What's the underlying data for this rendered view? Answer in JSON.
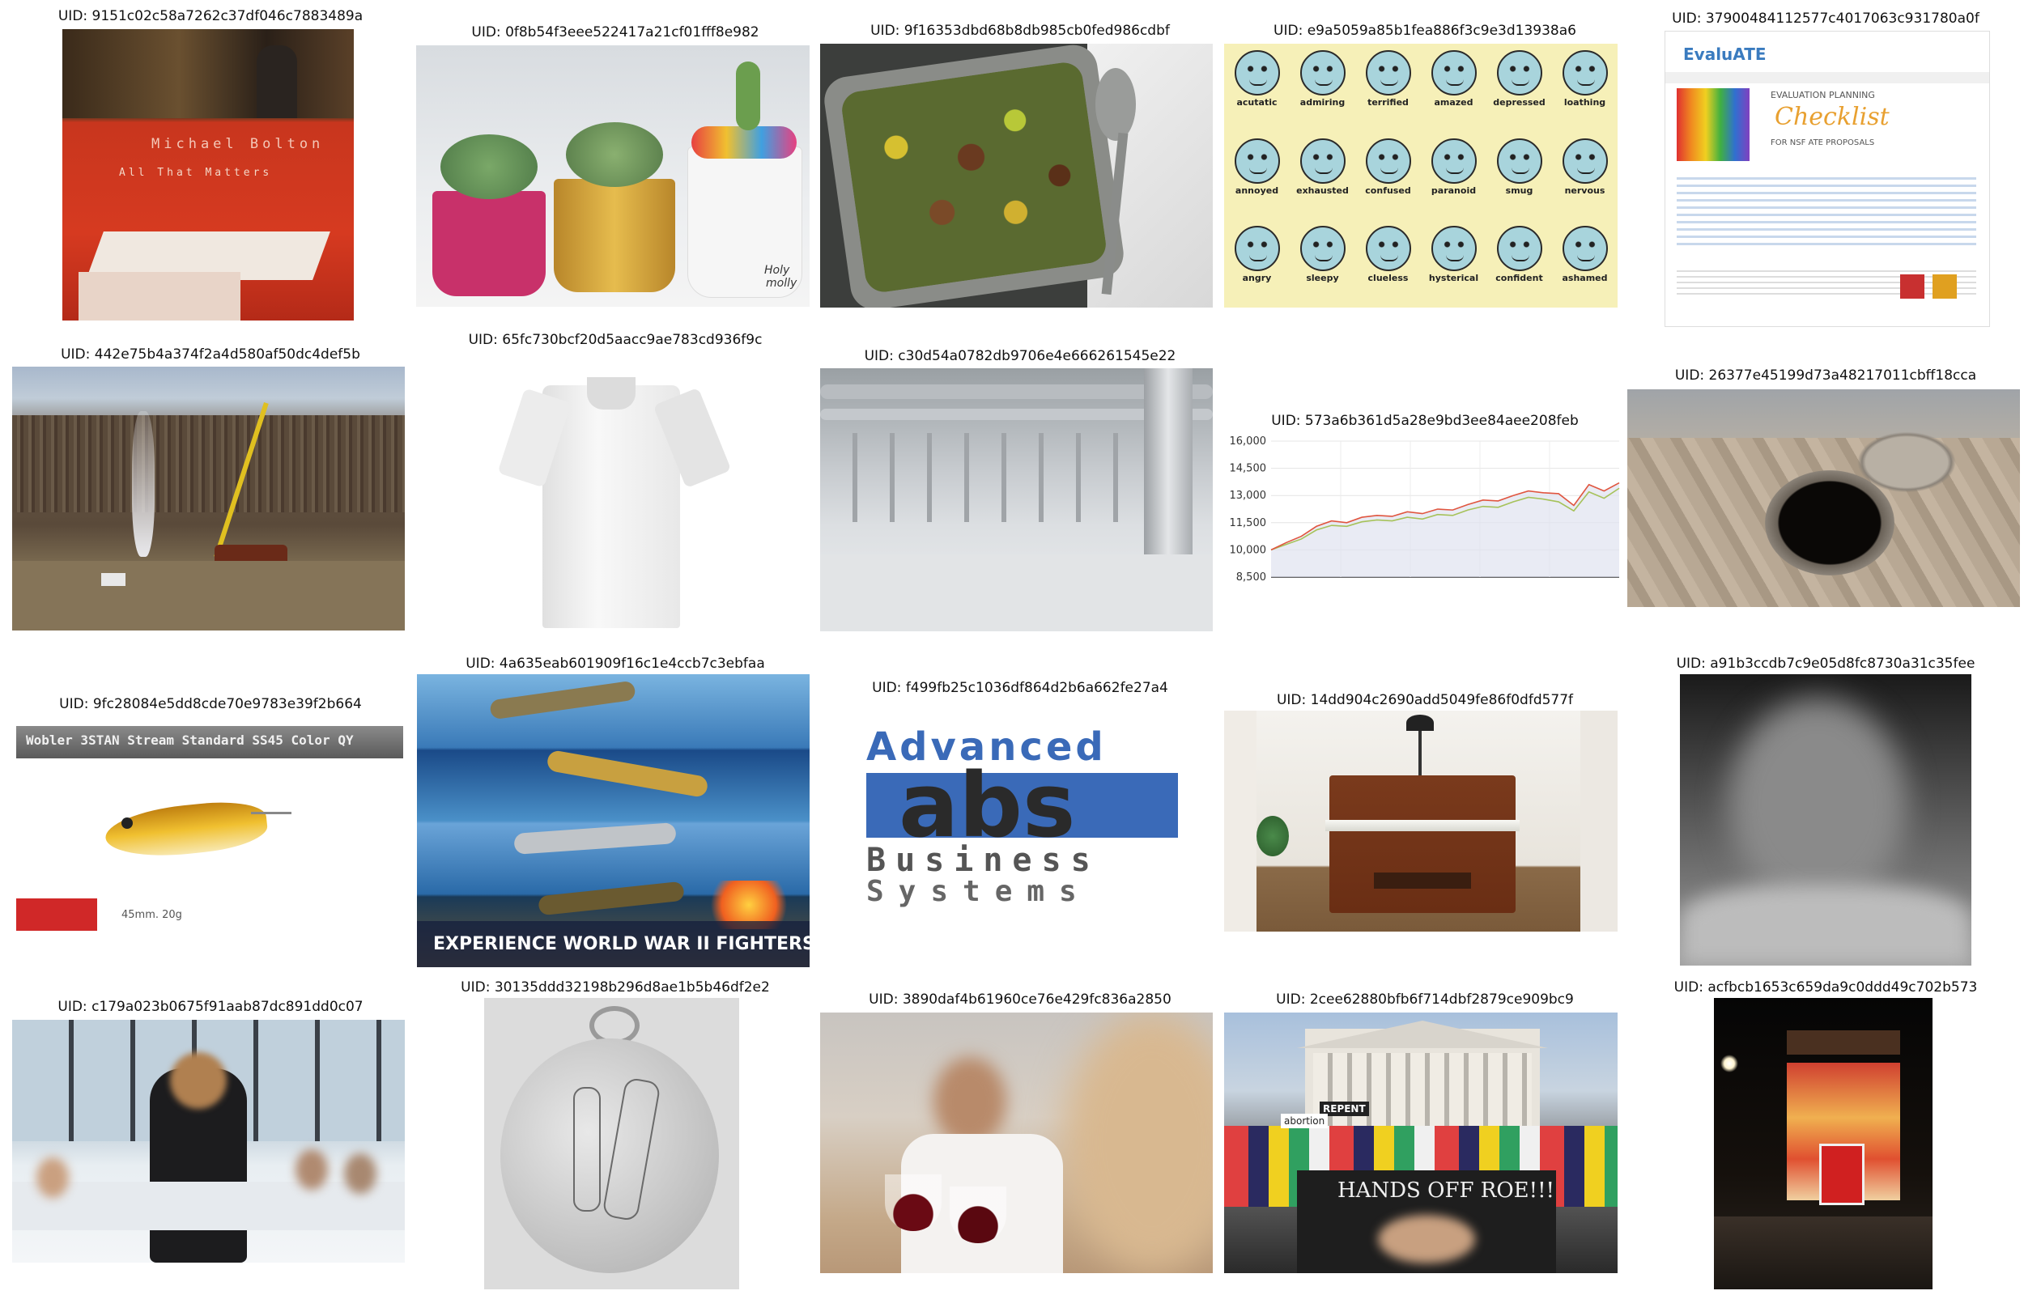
{
  "uid_prefix": "UID: ",
  "cells": [
    {
      "uid": "9151c02c58a7262c37df046c7883489a",
      "image_text": [
        "Michael Bolton",
        "All That Matters"
      ]
    },
    {
      "uid": "0f8b54f3eee522417a21cf01fff8e982",
      "image_text": [
        "Holy",
        "molly"
      ]
    },
    {
      "uid": "9f16353dbd68b8db985cb0fed986cdbf",
      "image_text": []
    },
    {
      "uid": "e9a5059a85b1fea886f3c9e3d13938a6",
      "image_text": [
        "acutatic",
        "admiring",
        "terrified",
        "amazed",
        "depressed",
        "loathing",
        "annoyed",
        "exhausted",
        "confused",
        "paranoid",
        "smug",
        "nervous",
        "angry",
        "sleepy",
        "clueless",
        "hysterical",
        "confident",
        "ashamed"
      ]
    },
    {
      "uid": "37900484112577c4017063c931780a0f",
      "image_text": [
        "EvaluATE",
        "EVALUATION PLANNING",
        "Checklist",
        "FOR NSF ATE PROPOSALS"
      ]
    },
    {
      "uid": "442e75b4a374f2a4d580af50dc4def5b",
      "image_text": []
    },
    {
      "uid": "65fc730bcf20d5aacc9ae783cd936f9c",
      "image_text": []
    },
    {
      "uid": "c30d54a0782db9706e4e666261545e22",
      "image_text": []
    },
    {
      "uid": "573a6b361d5a28e9bd3ee84aee208feb",
      "image_text": []
    },
    {
      "uid": "26377e45199d73a48217011cbff18cca",
      "image_text": []
    },
    {
      "uid": "9fc28084e5dd8cde70e9783e39f2b664",
      "image_text": [
        "Wobler 3STAN Stream Standard SS45 Color QY",
        "45mm. 20g"
      ]
    },
    {
      "uid": "4a635eab601909f16c1e4ccb7c3ebfaa",
      "image_text": [
        "EXPERIENCE WORLD WAR II FIGHTERS"
      ]
    },
    {
      "uid": "f499fb25c1036df864d2b6a662fe27a4",
      "image_text": [
        "Advanced",
        "abs",
        "Business",
        "Systems"
      ]
    },
    {
      "uid": "14dd904c2690add5049fe86f0dfd577f",
      "image_text": []
    },
    {
      "uid": "a91b3ccdb7c9e05d8fc8730a31c35fee",
      "image_text": []
    },
    {
      "uid": "c179a023b0675f91aab87dc891dd0c07",
      "image_text": []
    },
    {
      "uid": "30135ddd32198b296d8ae1b5b46df2e2",
      "image_text": []
    },
    {
      "uid": "3890daf4b61960ce76e429fc836a2850",
      "image_text": []
    },
    {
      "uid": "2cee62880bfb6f714dbf2879ce909bc9",
      "image_text": [
        "HANDS OFF ROE!!!",
        "REPENT",
        "abortion"
      ]
    },
    {
      "uid": "acfbcb1653c659da9c0ddd49c702b573",
      "image_text": []
    }
  ],
  "chart_data": {
    "type": "line",
    "title": "",
    "xlabel": "",
    "ylabel": "",
    "y_ticks": [
      "16,000",
      "14,500",
      "13,000",
      "11,500",
      "10,000",
      "8,500"
    ],
    "ylim": [
      8500,
      16000
    ],
    "grid": true,
    "series": [
      {
        "values": [
          10000,
          10400,
          10750,
          11300,
          11600,
          11500,
          11800,
          11900,
          11850,
          12100,
          12000,
          12250,
          12200,
          12500,
          12750,
          12700,
          13000,
          13250,
          13150,
          13100,
          12450,
          13600,
          13250,
          13700
        ]
      },
      {
        "values": [
          10000,
          10300,
          10600,
          11100,
          11350,
          11300,
          11550,
          11650,
          11600,
          11800,
          11700,
          11950,
          11900,
          12200,
          12400,
          12350,
          12650,
          12900,
          12800,
          12650,
          12150,
          13200,
          12850,
          13400
        ]
      }
    ],
    "colors": [
      "#e0553f",
      "#a6c25a"
    ]
  }
}
